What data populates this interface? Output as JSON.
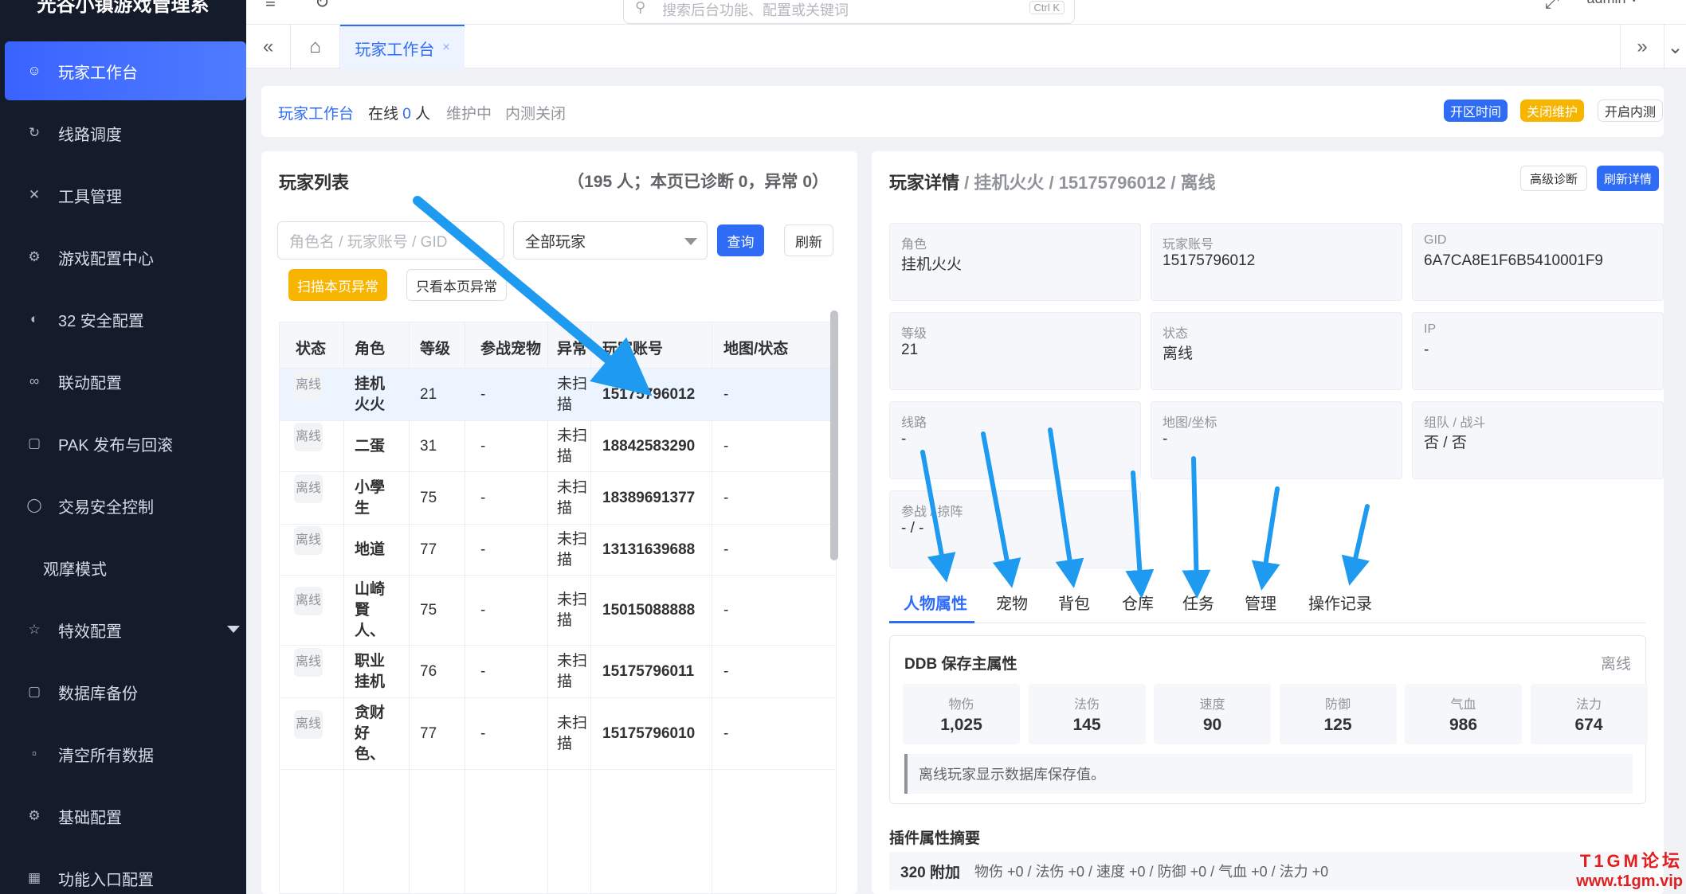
{
  "app": {
    "title": "光谷小镇游戏管理系"
  },
  "sidebar": {
    "items": [
      {
        "label": "玩家工作台",
        "icon": "user-icon"
      },
      {
        "label": "线路调度",
        "icon": "refresh-icon"
      },
      {
        "label": "工具管理",
        "icon": "tools-icon"
      },
      {
        "label": "游戏配置中心",
        "icon": "gear-icon"
      },
      {
        "label": "32 安全配置",
        "icon": "security-icon"
      },
      {
        "label": "联动配置",
        "icon": "link-icon"
      },
      {
        "label": "PAK 发布与回滚",
        "icon": "document-icon"
      },
      {
        "label": "交易安全控制",
        "icon": "shield-icon"
      },
      {
        "label": "观摩模式",
        "icon": ""
      },
      {
        "label": "特效配置",
        "icon": "star-icon"
      },
      {
        "label": "数据库备份",
        "icon": "document-icon"
      },
      {
        "label": "清空所有数据",
        "icon": "trash-icon"
      },
      {
        "label": "基础配置",
        "icon": "gear-icon"
      },
      {
        "label": "功能入口配置",
        "icon": "grid-icon"
      }
    ]
  },
  "header": {
    "search_placeholder": "搜索后台功能、配置或关键词",
    "search_shortcut": "Ctrl K",
    "user": "admin"
  },
  "tabs": {
    "active_label": "玩家工作台",
    "close": "×"
  },
  "statusbar": {
    "title": "玩家工作台",
    "online_prefix": "在线",
    "online_count": "0",
    "online_suffix": "人",
    "maintenance": "维护中",
    "internal_test": "内测关闭",
    "btn_open_time": "开区时间",
    "btn_close_maint": "关闭维护",
    "btn_open_test": "开启内测"
  },
  "player_list": {
    "title": "玩家列表",
    "summary": "（195 人；本页已诊断 0，异常 0）",
    "search_placeholder": "角色名 / 玩家账号 / GID",
    "filter_value": "全部玩家",
    "btn_query": "查询",
    "btn_refresh": "刷新",
    "btn_scan": "扫描本页异常",
    "btn_only_abnormal": "只看本页异常",
    "columns": [
      "状态",
      "角色",
      "等级",
      "参战宠物",
      "异常",
      "玩家账号",
      "地图/状态"
    ],
    "rows": [
      {
        "status": "离线",
        "role": "挂机火火",
        "level": "21",
        "pet": "-",
        "abnormal": "未扫描",
        "account": "15175796012",
        "map": "-"
      },
      {
        "status": "离线",
        "role": "二蛋",
        "level": "31",
        "pet": "-",
        "abnormal": "未扫描",
        "account": "18842583290",
        "map": "-"
      },
      {
        "status": "离线",
        "role": "小學生",
        "level": "75",
        "pet": "-",
        "abnormal": "未扫描",
        "account": "18389691377",
        "map": "-"
      },
      {
        "status": "离线",
        "role": "地道",
        "level": "77",
        "pet": "-",
        "abnormal": "未扫描",
        "account": "13131639688",
        "map": "-"
      },
      {
        "status": "离线",
        "role": "山崎賢人、",
        "level": "75",
        "pet": "-",
        "abnormal": "未扫描",
        "account": "15015088888",
        "map": "-"
      },
      {
        "status": "离线",
        "role": "职业挂机",
        "level": "76",
        "pet": "-",
        "abnormal": "未扫描",
        "account": "15175796011",
        "map": "-"
      },
      {
        "status": "离线",
        "role": "贪财好色、",
        "level": "77",
        "pet": "-",
        "abnormal": "未扫描",
        "account": "15175796010",
        "map": "-"
      }
    ]
  },
  "player_detail": {
    "title": "玩家详情",
    "breadcrumb": " / 挂机火火 / 15175796012 / 离线",
    "btn_advanced": "高级诊断",
    "btn_refresh": "刷新详情",
    "fields": [
      {
        "label": "角色",
        "value": "挂机火火"
      },
      {
        "label": "玩家账号",
        "value": "15175796012"
      },
      {
        "label": "GID",
        "value": "6A7CA8E1F6B5410001F9"
      },
      {
        "label": "等级",
        "value": "21"
      },
      {
        "label": "状态",
        "value": "离线"
      },
      {
        "label": "IP",
        "value": "-"
      },
      {
        "label": "线路",
        "value": "-"
      },
      {
        "label": "地图/坐标",
        "value": "-"
      },
      {
        "label": "组队 / 战斗",
        "value": "否 / 否"
      },
      {
        "label": "参战 / 掠阵",
        "value": "- / -"
      }
    ],
    "tabs": [
      "人物属性",
      "宠物",
      "背包",
      "仓库",
      "任务",
      "管理",
      "操作记录"
    ],
    "attr_title": "DDB 保存主属性",
    "attr_status": "离线",
    "attrs": [
      {
        "label": "物伤",
        "value": "1,025"
      },
      {
        "label": "法伤",
        "value": "145"
      },
      {
        "label": "速度",
        "value": "90"
      },
      {
        "label": "防御",
        "value": "125"
      },
      {
        "label": "气血",
        "value": "986"
      },
      {
        "label": "法力",
        "value": "674"
      }
    ],
    "attr_note": "离线玩家显示数据库保存值。",
    "plugin_title": "插件属性摘要",
    "plugin_key": "320 附加",
    "plugin_value": "物伤 +0 / 法伤 +0 / 速度 +0 / 防御 +0 / 气血 +0 / 法力 +0"
  },
  "watermark": {
    "line1": "T1GM论坛",
    "line2": "www.t1gm.vip"
  },
  "colors": {
    "accent": "#2f6cf6",
    "sidebar": "#141c2b",
    "warning": "#f7b500",
    "annotation_arrow": "#1e9af0",
    "watermark": "#e02020"
  }
}
